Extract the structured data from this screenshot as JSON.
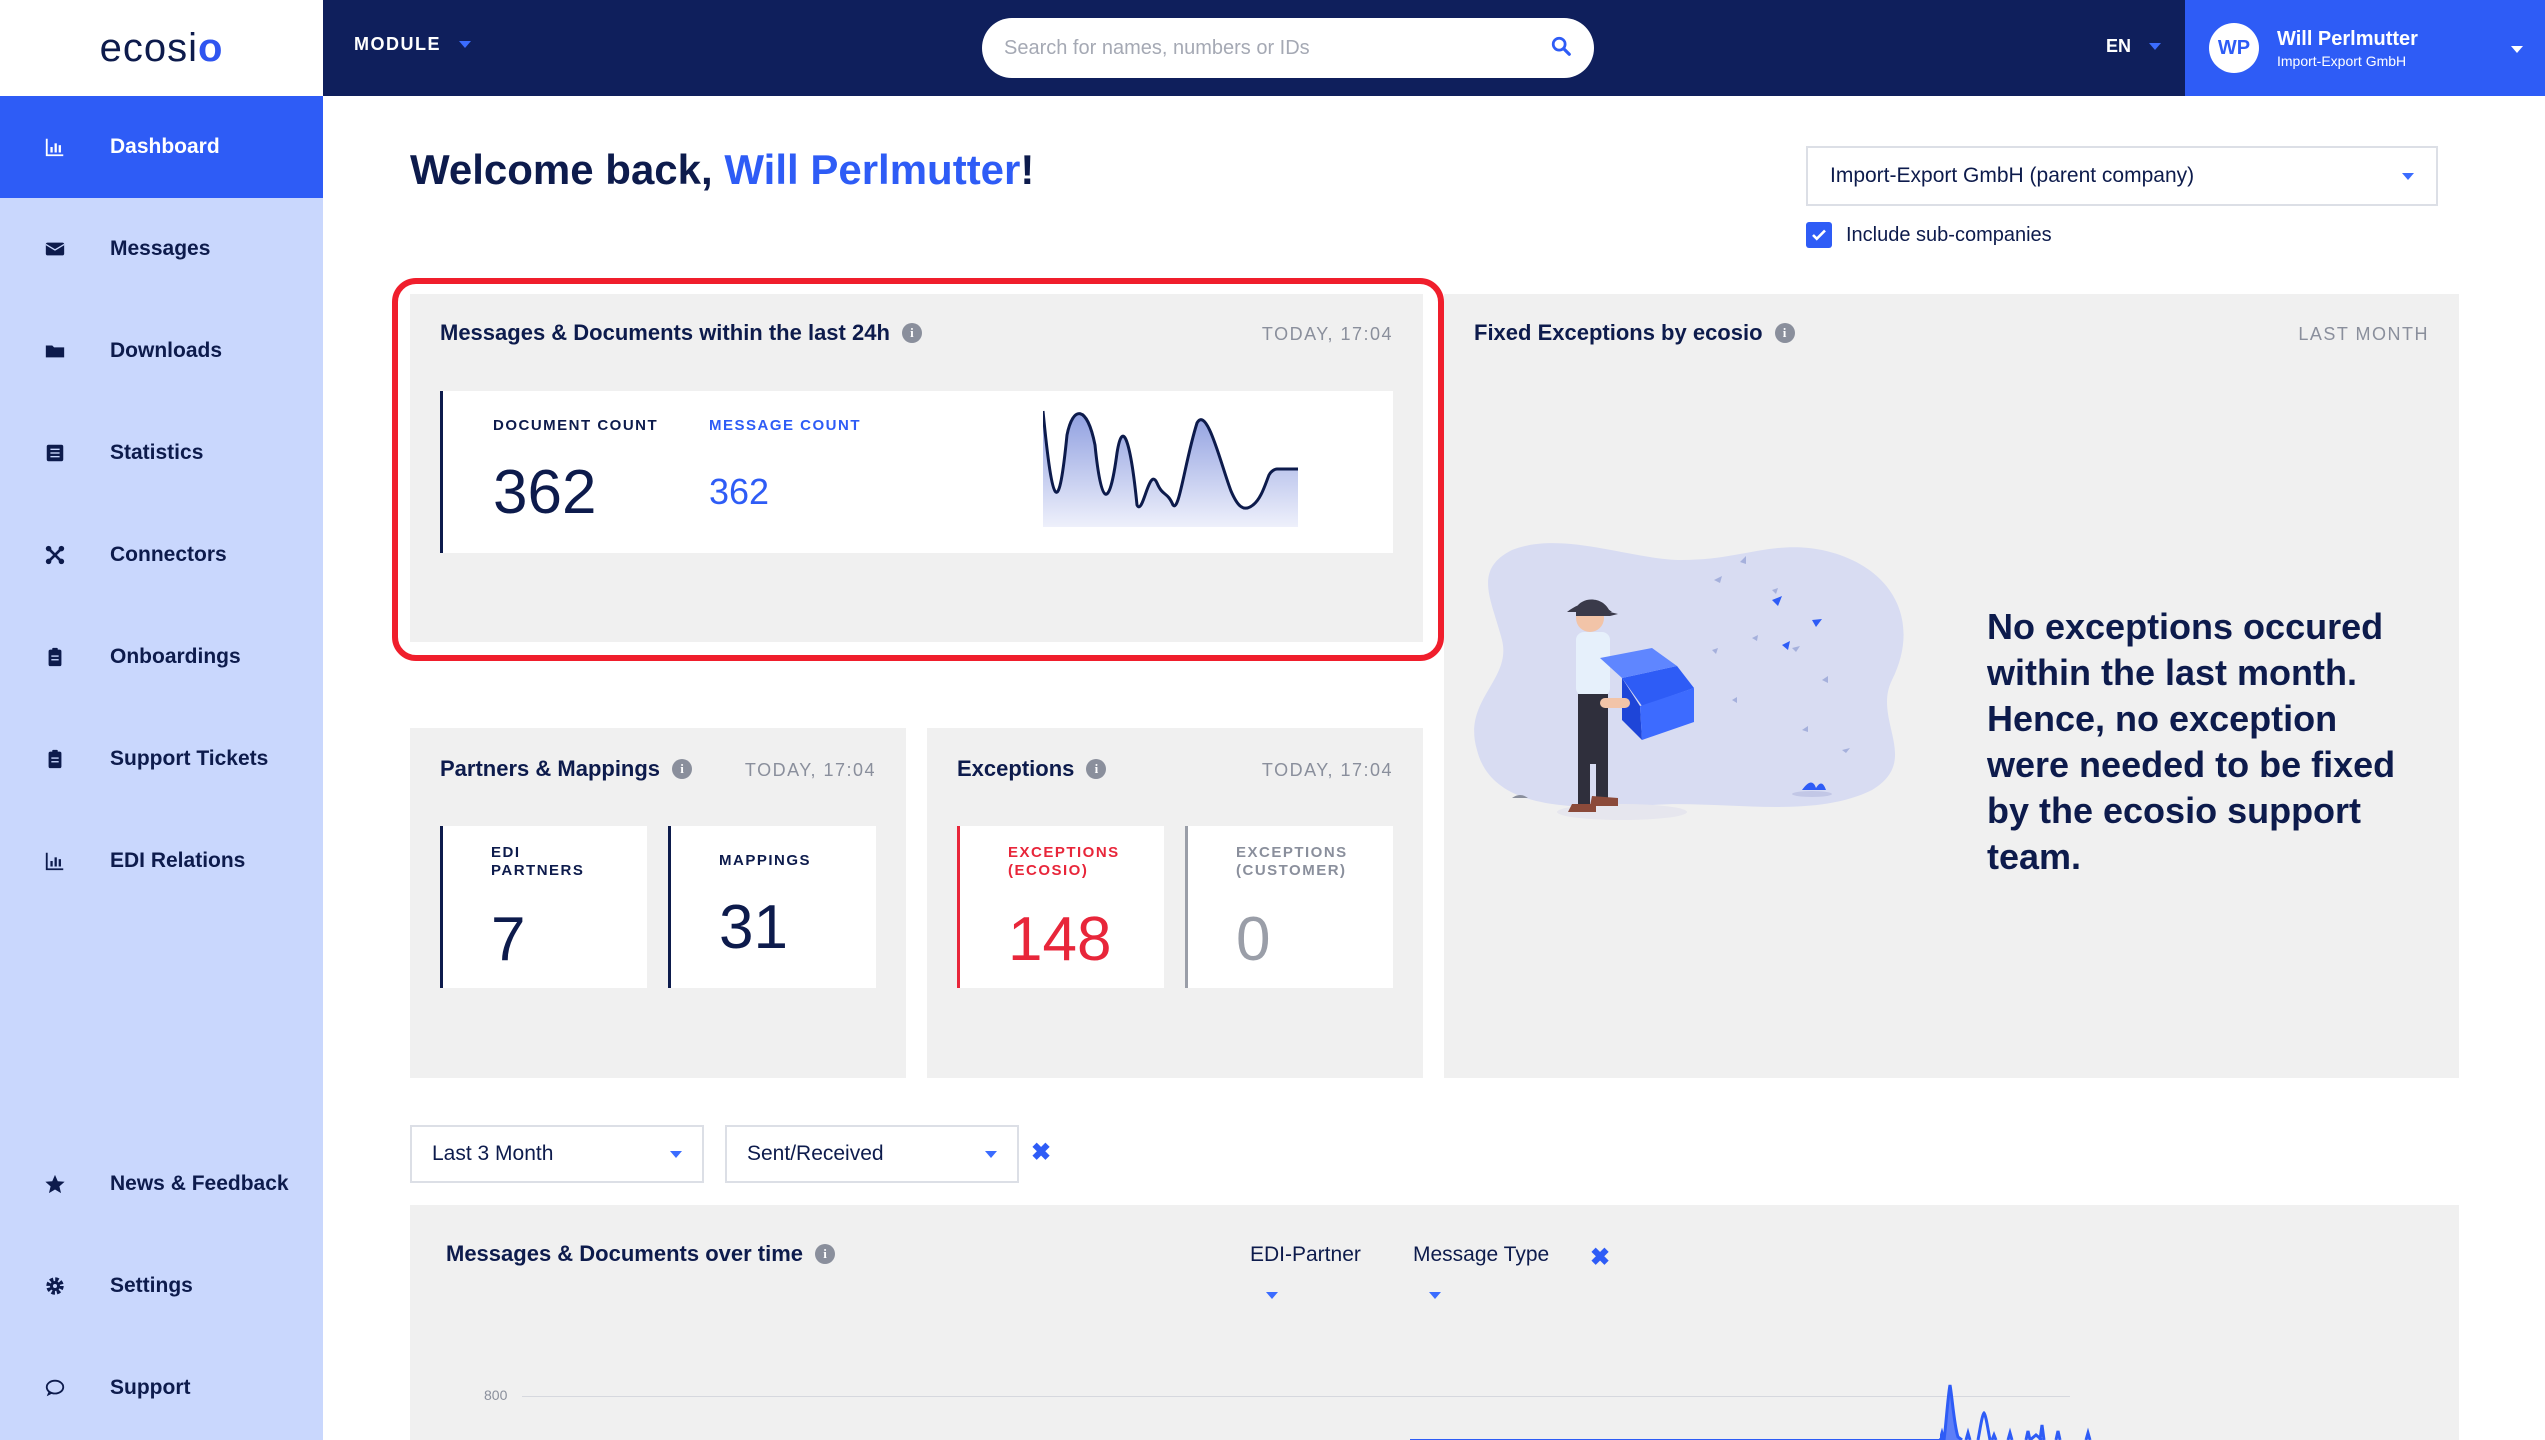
{
  "header": {
    "logo": "ecosio",
    "module_label": "MODULE",
    "search_placeholder": "Search for names, numbers or IDs",
    "language": "EN",
    "user": {
      "initials": "WP",
      "name": "Will Perlmutter",
      "company": "Import-Export GmbH"
    }
  },
  "sidebar": {
    "items": [
      {
        "label": "Dashboard",
        "icon": "bar-chart-icon",
        "active": true
      },
      {
        "label": "Messages",
        "icon": "envelope-icon"
      },
      {
        "label": "Downloads",
        "icon": "folder-icon"
      },
      {
        "label": "Statistics",
        "icon": "list-icon"
      },
      {
        "label": "Connectors",
        "icon": "connectors-icon"
      },
      {
        "label": "Onboardings",
        "icon": "clipboard-icon"
      },
      {
        "label": "Support Tickets",
        "icon": "ticket-icon"
      },
      {
        "label": "EDI Relations",
        "icon": "bar-chart-icon"
      },
      {
        "label": "News & Feedback",
        "icon": "star-icon"
      },
      {
        "label": "Settings",
        "icon": "gear-icon"
      },
      {
        "label": "Support",
        "icon": "chat-bubble-icon"
      }
    ]
  },
  "welcome": {
    "prefix": "Welcome back, ",
    "name": "Will Perlmutter",
    "suffix": "!"
  },
  "company_selector": {
    "value": "Import-Export GmbH (parent company)",
    "include_sub_label": "Include sub-companies",
    "include_sub_checked": true
  },
  "cards": {
    "messages_24h": {
      "title": "Messages & Documents within the last 24h",
      "time": "TODAY, 17:04",
      "document_count_label": "DOCUMENT COUNT",
      "document_count": "362",
      "message_count_label": "MESSAGE COUNT",
      "message_count": "362"
    },
    "fixed_exceptions": {
      "title": "Fixed Exceptions by ecosio",
      "time": "LAST MONTH",
      "message": "No exceptions occured within the last month. Hence, no exception were needed to be fixed by the ecosio support team."
    },
    "partners_mappings": {
      "title": "Partners & Mappings",
      "time": "TODAY, 17:04",
      "edi_partners_label_1": "EDI",
      "edi_partners_label_2": "PARTNERS",
      "edi_partners": "7",
      "mappings_label": "MAPPINGS",
      "mappings": "31"
    },
    "exceptions": {
      "title": "Exceptions",
      "time": "TODAY, 17:04",
      "ecosio_label_1": "EXCEPTIONS",
      "ecosio_label_2": "(ECOSIO)",
      "ecosio_value": "148",
      "customer_label_1": "EXCEPTIONS",
      "customer_label_2": "(CUSTOMER)",
      "customer_value": "0"
    },
    "over_time": {
      "title": "Messages & Documents over time",
      "edi_partner_filter": "EDI-Partner",
      "message_type_filter": "Message Type",
      "y_tick": "800"
    }
  },
  "filters": {
    "period": "Last 3 Month",
    "direction": "Sent/Received"
  },
  "colors": {
    "brand_navy": "#0f1f5c",
    "accent_blue": "#2e5cf6",
    "sidebar_bg": "#c9d7fd",
    "exception_red": "#e8263a",
    "highlight_red": "#f01e2c"
  }
}
